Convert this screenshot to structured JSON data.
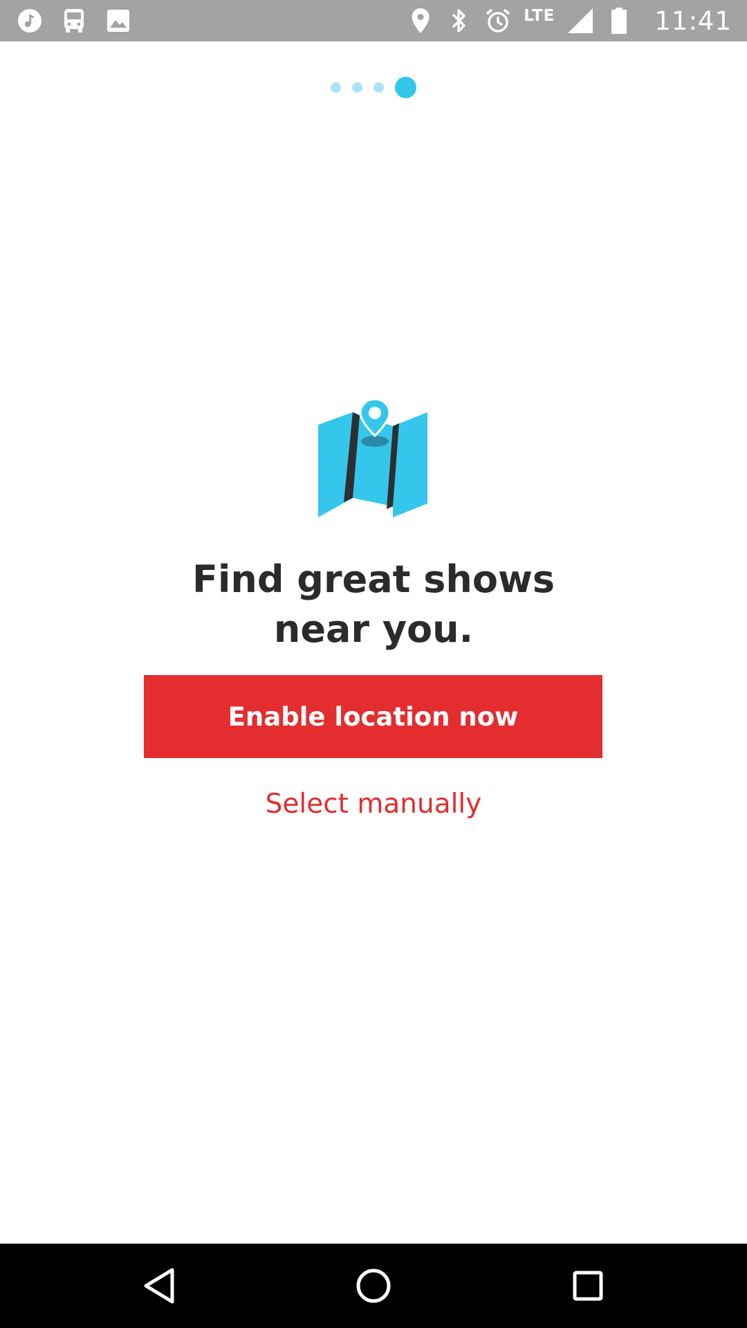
{
  "status_bar": {
    "left_icons": [
      "music-note-icon",
      "bus-icon",
      "image-icon"
    ],
    "right_icons": [
      "location-pin-icon",
      "bluetooth-icon",
      "alarm-icon",
      "signal-icon",
      "battery-icon"
    ],
    "network_label": "LTE",
    "time": "11:41"
  },
  "pager": {
    "total": 4,
    "active_index": 3
  },
  "illustration": {
    "icon": "folded-map-with-pin-icon"
  },
  "headline": {
    "line1": "Find great shows",
    "line2": "near you."
  },
  "actions": {
    "enable_label": "Enable location now",
    "manual_label": "Select manually"
  },
  "nav_bar": {
    "buttons": [
      "back-icon",
      "home-icon",
      "recents-icon"
    ]
  },
  "colors": {
    "accent_red": "#e32d2f",
    "accent_blue": "#35c7eb",
    "dot_inactive": "#a7e4f4",
    "status_bar_bg": "#a3a3a3",
    "text_dark": "#2b2b2b"
  }
}
